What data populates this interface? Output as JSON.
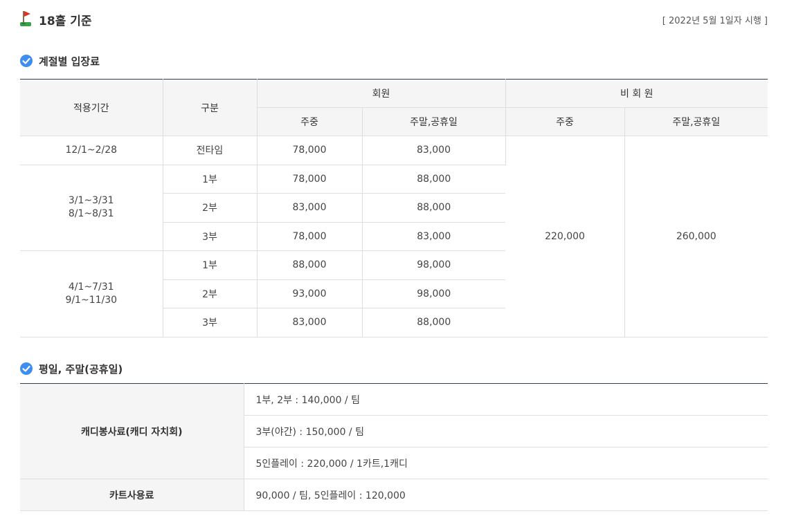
{
  "header": {
    "title": "18홀 기준",
    "effective_note": "[ 2022년 5월 1일자 시행 ]"
  },
  "section1": {
    "title": "계절별 입장료",
    "headers": {
      "period": "적용기간",
      "category": "구분",
      "member": "회원",
      "nonmember": "비 회 원",
      "weekday": "주중",
      "weekend": "주말,공휴일"
    },
    "rows": [
      {
        "period_lines": [
          "12/1~2/28"
        ],
        "sessions": [
          {
            "label": "전타임",
            "member_weekday": "78,000",
            "member_weekend": "83,000"
          }
        ]
      },
      {
        "period_lines": [
          "3/1~3/31",
          "8/1~8/31"
        ],
        "sessions": [
          {
            "label": "1부",
            "member_weekday": "78,000",
            "member_weekend": "88,000"
          },
          {
            "label": "2부",
            "member_weekday": "83,000",
            "member_weekend": "88,000"
          },
          {
            "label": "3부",
            "member_weekday": "78,000",
            "member_weekend": "83,000"
          }
        ]
      },
      {
        "period_lines": [
          "4/1~7/31",
          "9/1~11/30"
        ],
        "sessions": [
          {
            "label": "1부",
            "member_weekday": "88,000",
            "member_weekend": "98,000"
          },
          {
            "label": "2부",
            "member_weekday": "93,000",
            "member_weekend": "98,000"
          },
          {
            "label": "3부",
            "member_weekday": "83,000",
            "member_weekend": "88,000"
          }
        ]
      }
    ],
    "nonmember_weekday": "220,000",
    "nonmember_weekend": "260,000"
  },
  "section2": {
    "title": "평일, 주말(공휴일)",
    "caddie_label": "캐디봉사료(캐디 자치회)",
    "caddie_lines": [
      "1부, 2부 : 140,000 / 팀",
      "3부(야간) : 150,000 / 팀",
      "5인플레이 : 220,000 / 1카트,1캐디"
    ],
    "cart_label": "카트사용료",
    "cart_value": "90,000 / 팀,  5인플레이 : 120,000"
  },
  "colors": {
    "header_bg": "#f5f5f5",
    "border": "#dedede",
    "table_top_border": "#2e3f4a",
    "check_blue": "#3d8ef0",
    "flag_red": "#e0301e",
    "grass_green": "#3aa14b"
  },
  "icons": {
    "title_icon": "golf-flag-icon",
    "section_icon": "check-circle-icon"
  }
}
